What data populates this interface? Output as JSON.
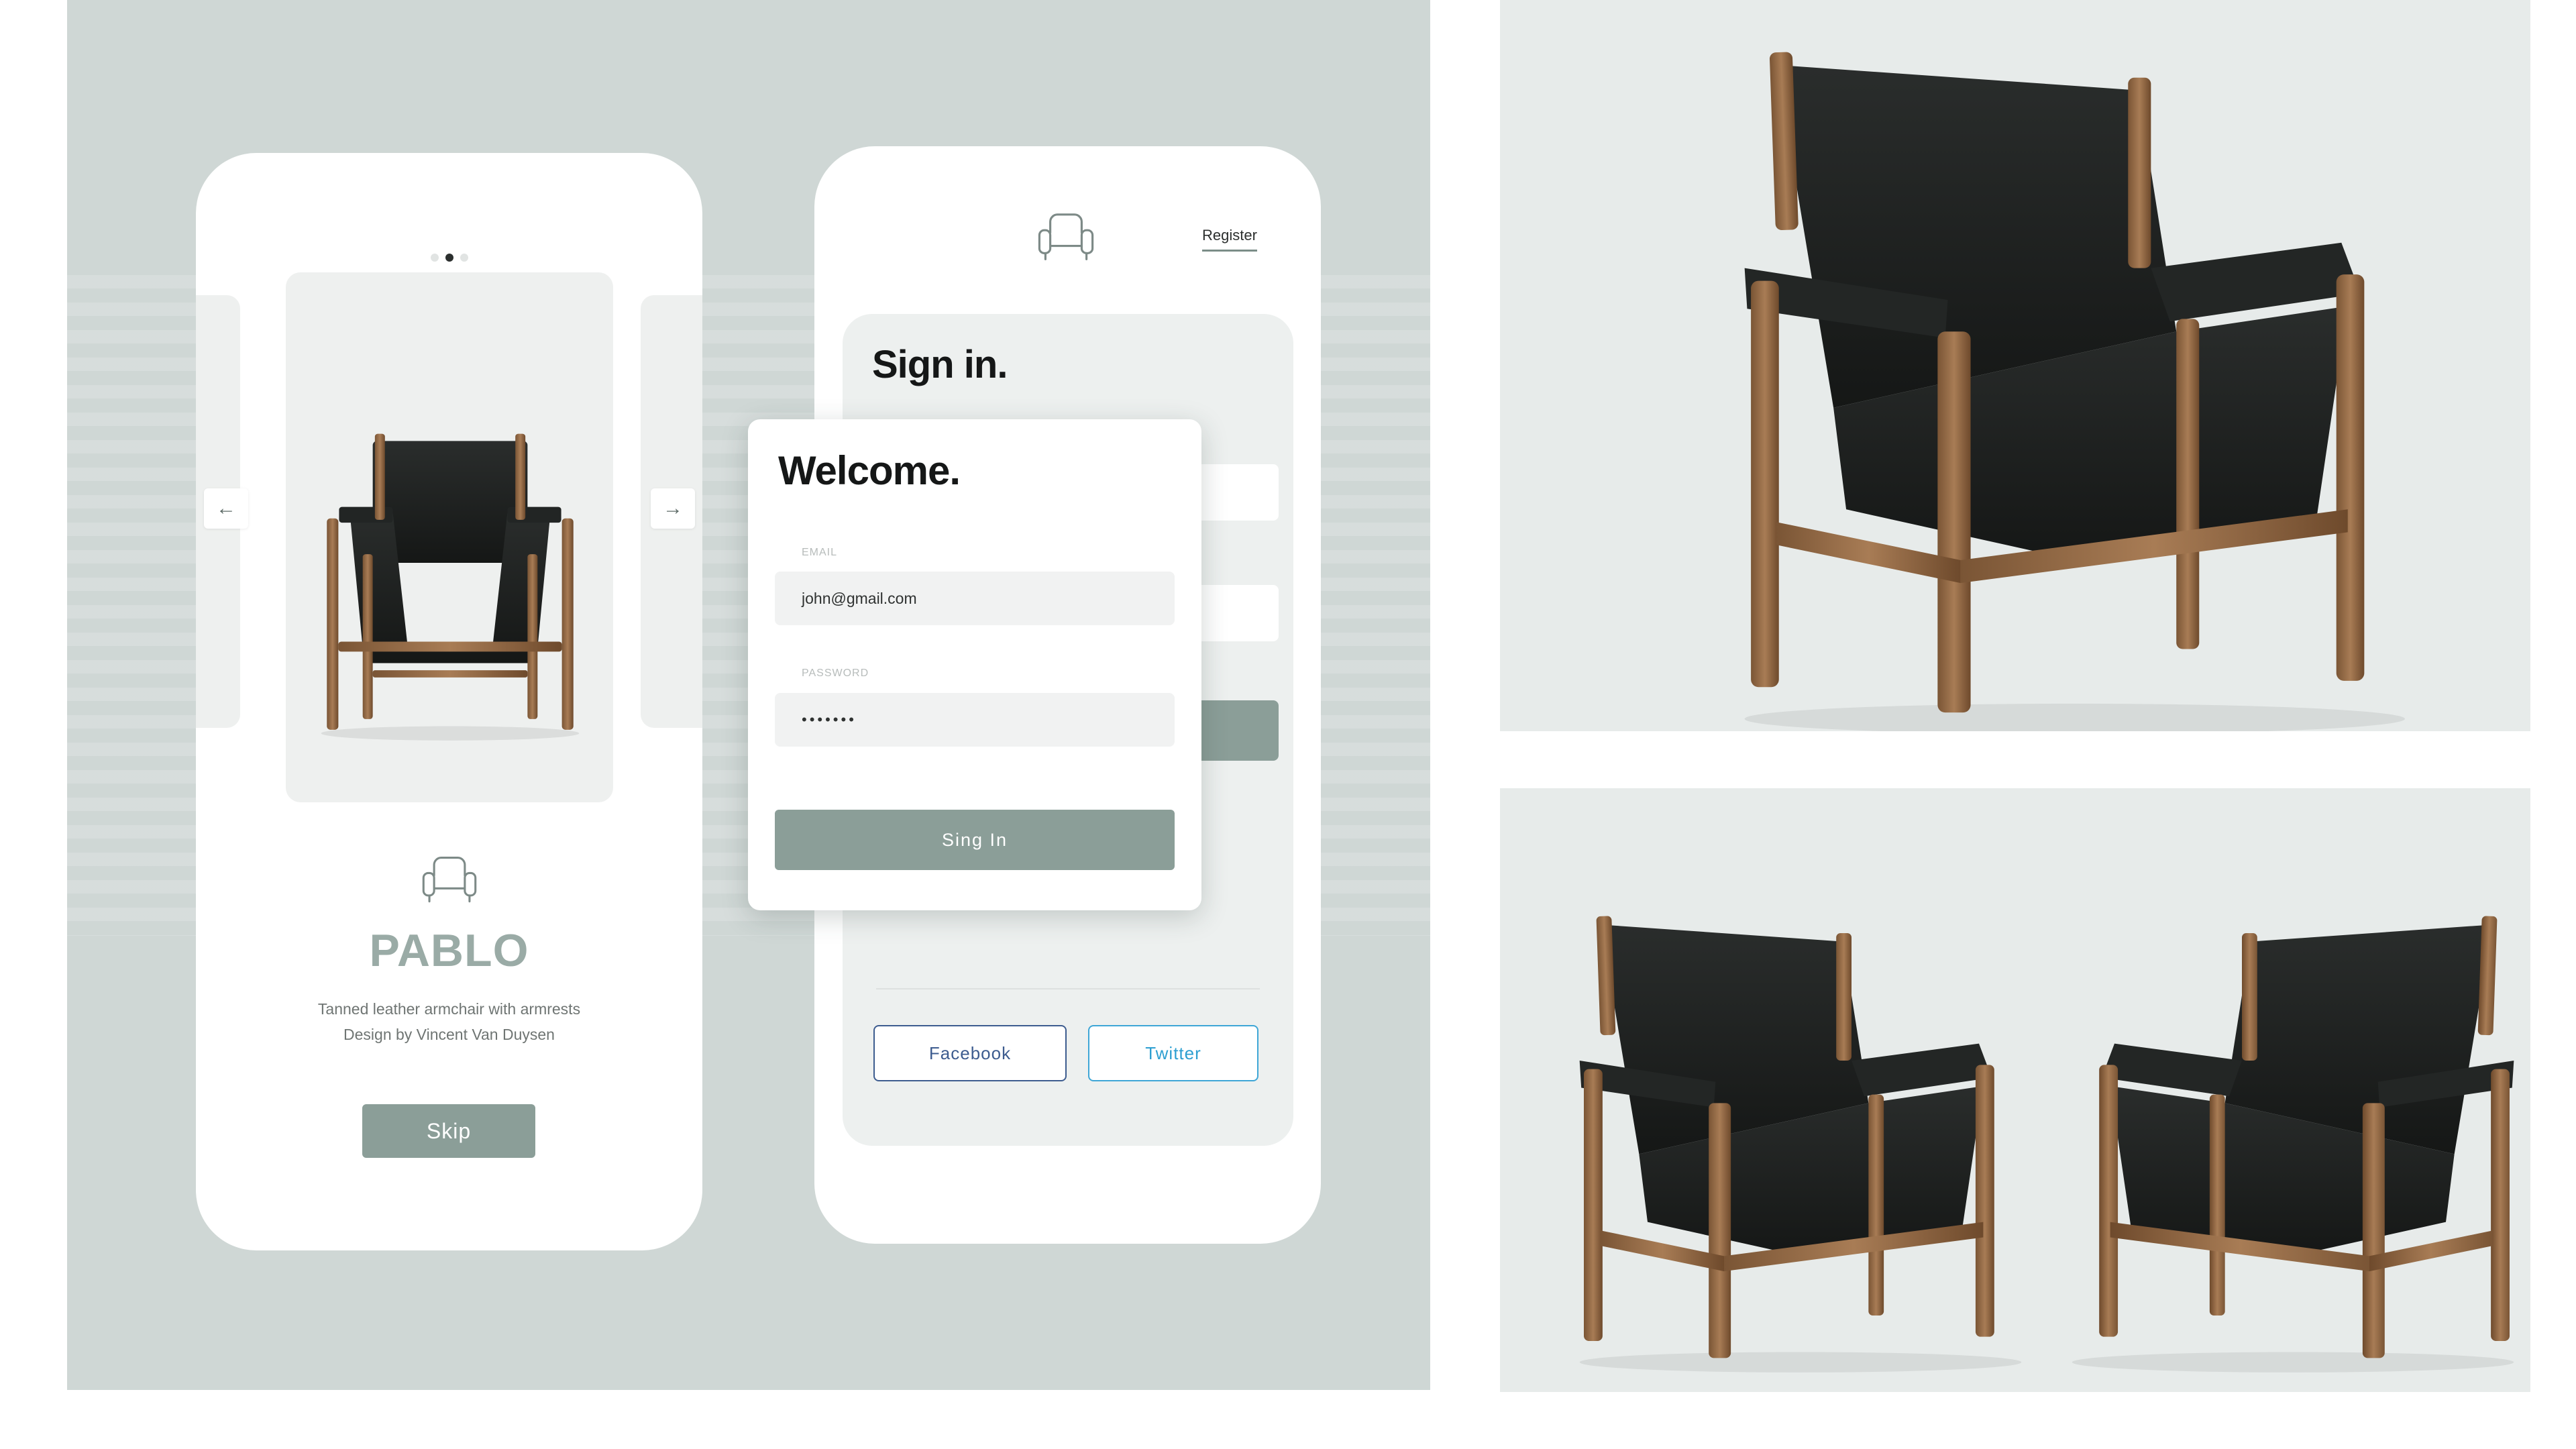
{
  "onboarding": {
    "product_name": "PABLO",
    "description_line1": "Tanned leather armchair with armrests",
    "description_line2": "Design by Vincent Van Duysen",
    "skip_label": "Skip",
    "prev_icon": "arrow-left-icon",
    "next_icon": "arrow-right-icon",
    "logo_icon": "armchair-icon"
  },
  "signin_screen": {
    "register_label": "Register",
    "title": "Sign in.",
    "facebook_label": "Facebook",
    "twitter_label": "Twitter",
    "logo_icon": "armchair-icon"
  },
  "welcome_card": {
    "title": "Welcome.",
    "email_label": "EMAIL",
    "email_value": "john@gmail.com",
    "password_label": "PASSWORD",
    "password_value": "•••••••",
    "submit_label": "Sing In"
  },
  "colors": {
    "background": "#cfd7d5",
    "accent": "#8b9e98",
    "product_name": "#9aaba6",
    "facebook": "#3d5c8f",
    "twitter": "#2d9fd1"
  }
}
